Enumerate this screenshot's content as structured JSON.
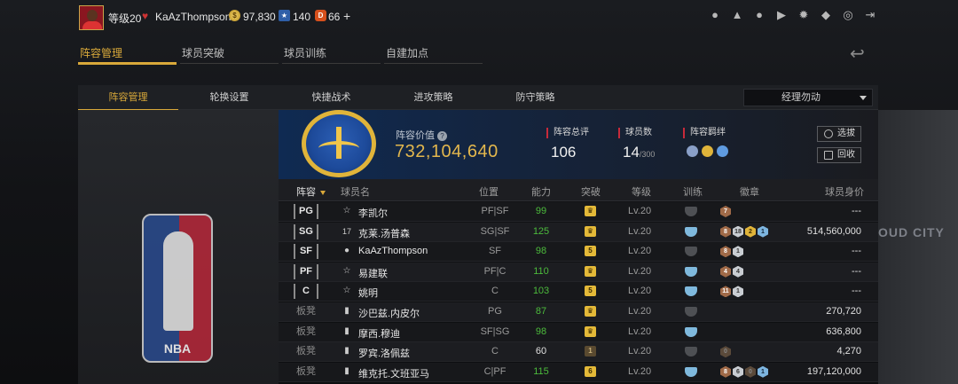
{
  "header": {
    "level": "等级20",
    "username": "KaAzThompson",
    "currencies": [
      {
        "icon": "gold-coin-icon",
        "value": "97,830"
      },
      {
        "icon": "star-ticket-icon",
        "value": "140"
      },
      {
        "icon": "ruby-icon",
        "value": "66"
      }
    ],
    "plus": "+",
    "icons": [
      "profile-icon",
      "notification-bell-icon",
      "friends-icon",
      "video-icon",
      "settings-gear-icon",
      "shield-icon",
      "support-headset-icon",
      "logout-icon"
    ]
  },
  "main_tabs": [
    "阵容管理",
    "球员突破",
    "球员训练",
    "自建加点"
  ],
  "sub_tabs": [
    "阵容管理",
    "轮换设置",
    "快捷战术",
    "进攻策略",
    "防守策略"
  ],
  "dropdown": {
    "selected": "经理勿动"
  },
  "summary": {
    "value_label": "阵容价值",
    "value": "732,104,640",
    "total_rating_label": "阵容总评",
    "total_rating": "106",
    "player_count_label": "球员数",
    "player_count": "14",
    "player_count_max": "/300",
    "bond_label": "阵容羁绊",
    "select_btn": "选拔",
    "recycle_btn": "回收"
  },
  "table": {
    "headers": {
      "lineup": "阵容",
      "name": "球员名",
      "position": "位置",
      "rating": "能力",
      "breakthrough": "突破",
      "level": "等级",
      "training": "训练",
      "badges": "徽章",
      "worth": "球员身价"
    },
    "rows": [
      {
        "slot": "PG",
        "starter": true,
        "icon": "☆",
        "name": "李凯尔",
        "pos": "PF|SF",
        "rating": "99",
        "rating_color": "green",
        "brk": "crown",
        "lv": "Lv.20",
        "train": "grey",
        "badges": [
          {
            "t": "bronze",
            "v": "7"
          }
        ],
        "worth": "---"
      },
      {
        "slot": "SG",
        "starter": true,
        "icon": "17",
        "name": "克莱.汤普森",
        "pos": "SG|SF",
        "rating": "125",
        "rating_color": "green",
        "brk": "crown",
        "lv": "Lv.20",
        "train": "blue",
        "badges": [
          {
            "t": "bronze",
            "v": "8"
          },
          {
            "t": "silver",
            "v": "18"
          },
          {
            "t": "gold",
            "v": "2"
          },
          {
            "t": "blue",
            "v": "1"
          }
        ],
        "worth": "514,560,000"
      },
      {
        "slot": "SF",
        "starter": true,
        "icon": "user",
        "name": "KaAzThompson",
        "pos": "SF",
        "rating": "98",
        "rating_color": "green",
        "brk": "5",
        "lv": "Lv.20",
        "train": "grey",
        "badges": [
          {
            "t": "bronze",
            "v": "8"
          },
          {
            "t": "silver",
            "v": "1"
          }
        ],
        "worth": "---"
      },
      {
        "slot": "PF",
        "starter": true,
        "icon": "☆",
        "name": "易建联",
        "pos": "PF|C",
        "rating": "110",
        "rating_color": "green",
        "brk": "crown",
        "lv": "Lv.20",
        "train": "blue",
        "badges": [
          {
            "t": "bronze",
            "v": "4"
          },
          {
            "t": "silver",
            "v": "4"
          }
        ],
        "worth": "---"
      },
      {
        "slot": "C",
        "starter": true,
        "icon": "☆",
        "name": "姚明",
        "pos": "C",
        "rating": "103",
        "rating_color": "green",
        "brk": "5",
        "lv": "Lv.20",
        "train": "blue",
        "badges": [
          {
            "t": "bronze",
            "v": "11"
          },
          {
            "t": "silver",
            "v": "1"
          }
        ],
        "worth": "---"
      },
      {
        "slot": "板凳",
        "starter": false,
        "icon": "bars",
        "name": "沙巴兹.内皮尔",
        "pos": "PG",
        "rating": "87",
        "rating_color": "green",
        "brk": "crown",
        "lv": "Lv.20",
        "train": "grey",
        "badges": [],
        "worth": "270,720"
      },
      {
        "slot": "板凳",
        "starter": false,
        "icon": "bars",
        "name": "摩西.穆迪",
        "pos": "SF|SG",
        "rating": "98",
        "rating_color": "green",
        "brk": "crown",
        "lv": "Lv.20",
        "train": "blue",
        "badges": [],
        "worth": "636,800"
      },
      {
        "slot": "板凳",
        "starter": false,
        "icon": "bars",
        "name": "罗宾.洛佩兹",
        "pos": "C",
        "rating": "60",
        "rating_color": "white",
        "brk": "1",
        "lv": "Lv.20",
        "train": "grey",
        "badges": [
          {
            "t": "dark",
            "v": "0"
          }
        ],
        "worth": "4,270"
      },
      {
        "slot": "板凳",
        "starter": false,
        "icon": "bars",
        "name": "维克托.文班亚马",
        "pos": "C|PF",
        "rating": "115",
        "rating_color": "green",
        "brk": "6",
        "lv": "Lv.20",
        "train": "blue",
        "badges": [
          {
            "t": "bronze",
            "v": "8"
          },
          {
            "t": "silver",
            "v": "6"
          },
          {
            "t": "dark",
            "v": "0"
          },
          {
            "t": "blue",
            "v": "1"
          }
        ],
        "worth": "197,120,000"
      }
    ]
  },
  "right_bg_text": "OUD CITY",
  "logo_text": "NBA"
}
